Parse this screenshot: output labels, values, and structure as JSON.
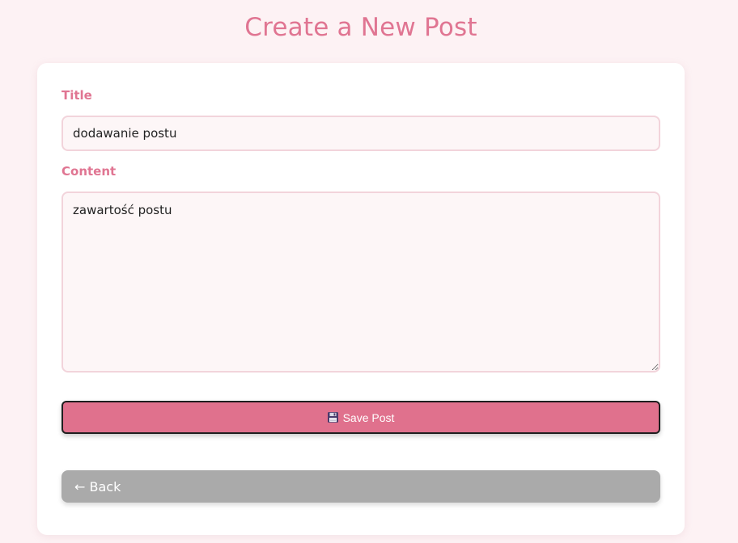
{
  "page": {
    "title": "Create a New Post"
  },
  "form": {
    "title_label": "Title",
    "title_value": "dodawanie postu",
    "content_label": "Content",
    "content_value": "zawartość postu",
    "save_label": "Save Post",
    "save_icon": "floppy-disk-icon",
    "back_label": "← Back"
  },
  "colors": {
    "background": "#fdf2f4",
    "accent": "#e07592",
    "save_button": "#e0718d",
    "back_button": "#aaaaaa",
    "input_background": "#fdf6f7",
    "input_border": "#f2d4db"
  }
}
